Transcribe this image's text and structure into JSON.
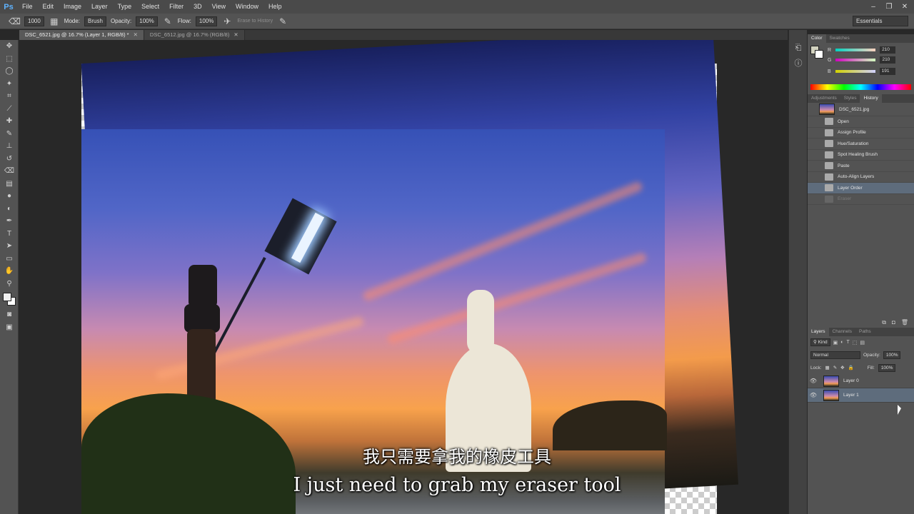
{
  "app": {
    "logo": "Ps",
    "menu": [
      "File",
      "Edit",
      "Image",
      "Layer",
      "Type",
      "Select",
      "Filter",
      "3D",
      "View",
      "Window",
      "Help"
    ],
    "window_controls": [
      "minimize-icon",
      "restore-icon",
      "close-icon"
    ]
  },
  "options": {
    "brush_size": "1000",
    "mode_label": "Mode:",
    "mode_value": "Brush",
    "opacity_label": "Opacity:",
    "opacity_value": "100%",
    "flow_label": "Flow:",
    "flow_value": "100%",
    "erase_history_label": "Erase to History",
    "workspace": "Essentials"
  },
  "tabs": [
    {
      "label": "DSC_6521.jpg @ 16.7% (Layer 1, RGB/8) *",
      "active": true
    },
    {
      "label": "DSC_6512.jpg @ 16.7% (RGB/8)",
      "active": false
    }
  ],
  "subtitles": {
    "chinese": "我只需要拿我的橡皮工具",
    "english": "I just need to grab my eraser tool"
  },
  "color_panel": {
    "tabs": [
      "Color",
      "Swatches"
    ],
    "r_label": "R",
    "r_value": "210",
    "g_label": "G",
    "g_value": "210",
    "b_label": "B",
    "b_value": "191"
  },
  "history_panel": {
    "tabs": [
      "Adjustments",
      "Styles",
      "History"
    ],
    "snapshot": "DSC_6521.jpg",
    "items": [
      "Open",
      "Assign Profile",
      "Hue/Saturation",
      "Spot Healing Brush",
      "Paste",
      "Auto-Align Layers",
      "Layer Order",
      "Eraser"
    ]
  },
  "layers_panel": {
    "tabs": [
      "Layers",
      "Channels",
      "Paths"
    ],
    "kind_label": "Kind",
    "blend_mode": "Normal",
    "opacity_label": "Opacity:",
    "opacity_value": "100%",
    "lock_label": "Lock:",
    "fill_label": "Fill:",
    "fill_value": "100%",
    "layers": [
      "Layer 0",
      "Layer 1"
    ]
  }
}
